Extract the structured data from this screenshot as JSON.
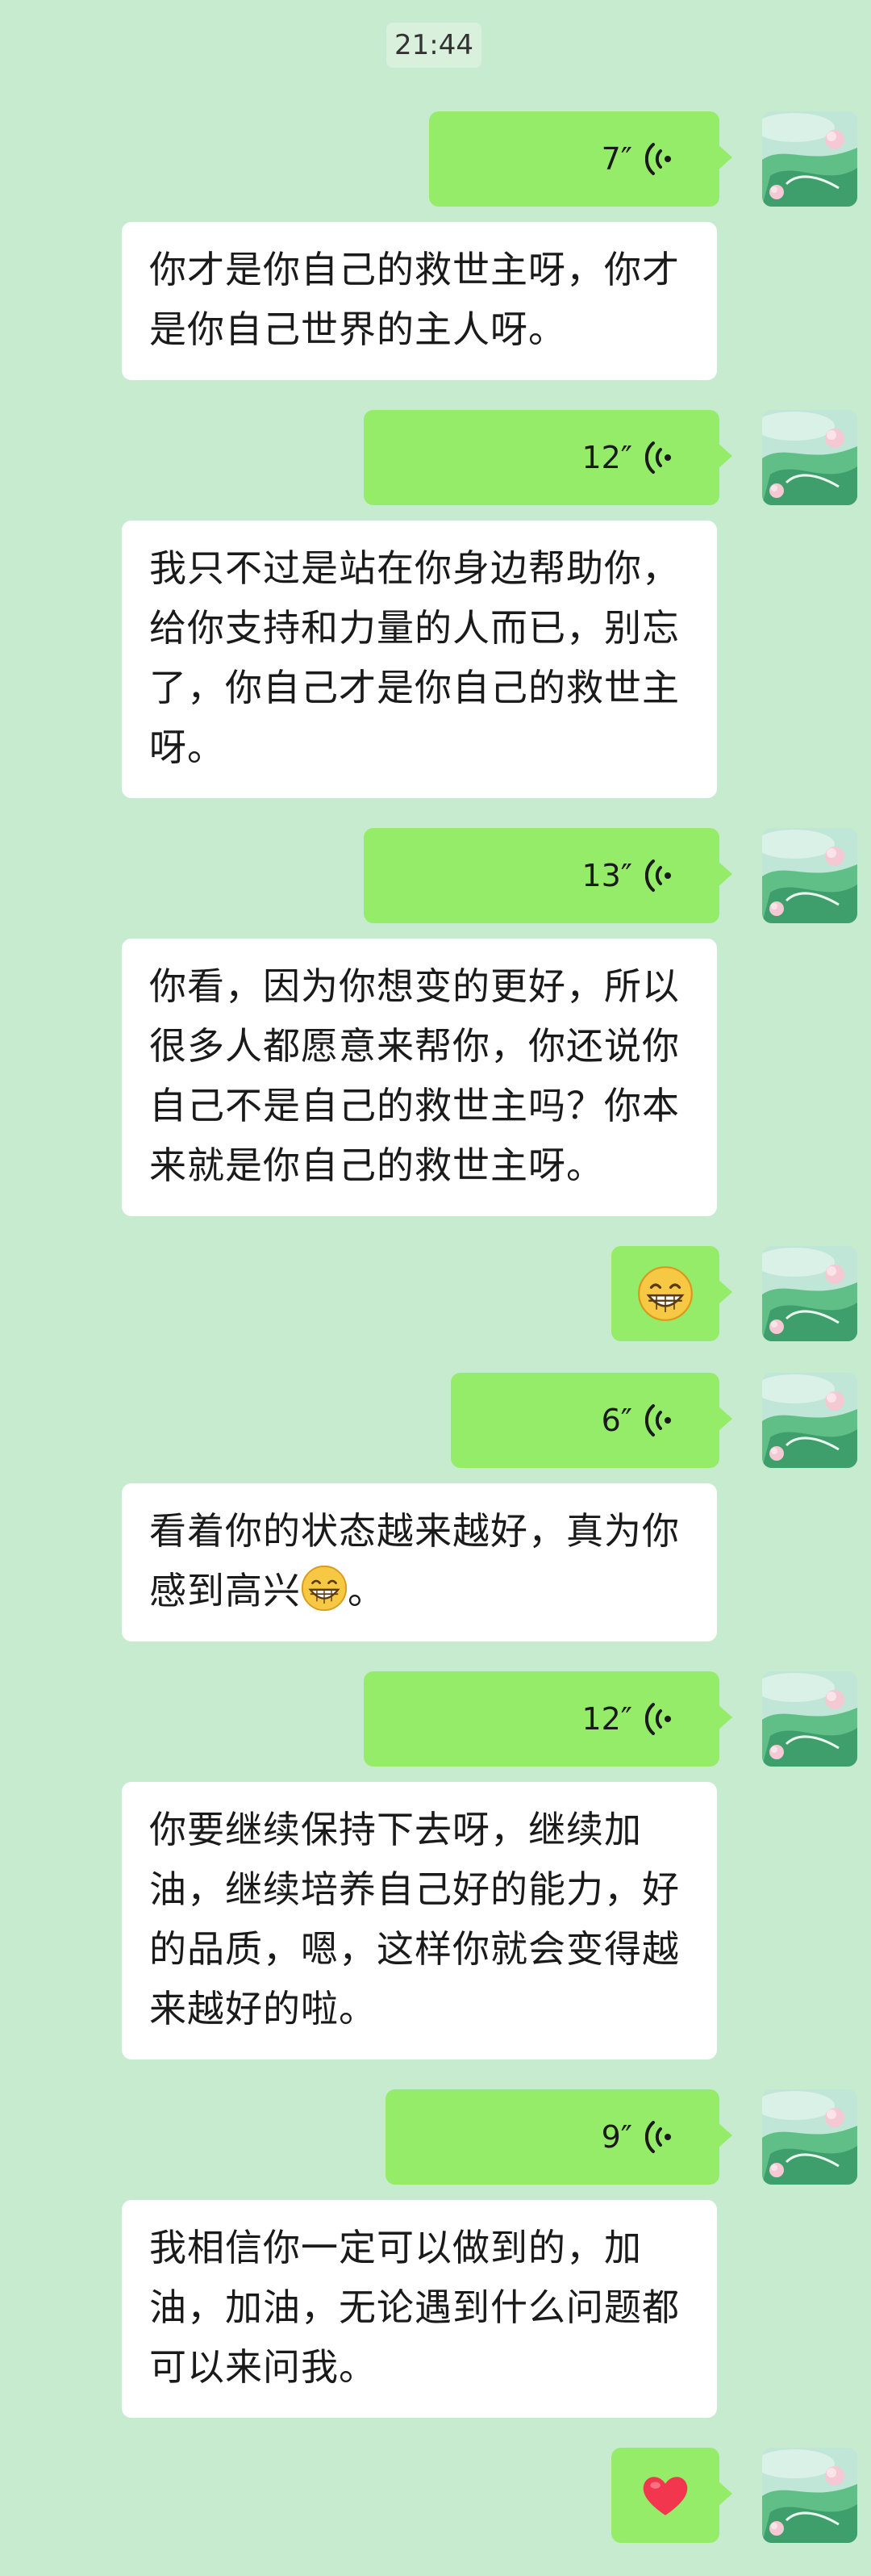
{
  "timestamp": "21:44",
  "colors": {
    "background": "#c7ebcf",
    "sent_bubble": "#95ec69",
    "received_bubble": "#ffffff"
  },
  "messages": [
    {
      "type": "voice",
      "duration": "7″"
    },
    {
      "type": "text",
      "text": "你才是你自己的救世主呀，你才是你自己世界的主人呀。"
    },
    {
      "type": "voice",
      "duration": "12″"
    },
    {
      "type": "text",
      "text": "我只不过是站在你身边帮助你，给你支持和力量的人而已，别忘了，你自己才是你自己的救世主呀。"
    },
    {
      "type": "voice",
      "duration": "13″"
    },
    {
      "type": "text",
      "text": "你看，因为你想变的更好，所以很多人都愿意来帮你，你还说你自己不是自己的救世主吗？你本来就是你自己的救世主呀。"
    },
    {
      "type": "emoji",
      "icon": "grinning-face-icon"
    },
    {
      "type": "voice",
      "duration": "6″"
    },
    {
      "type": "text",
      "text_before": "看着你的状态越来越好，真为你感到高兴",
      "text_after": "。"
    },
    {
      "type": "voice",
      "duration": "12″"
    },
    {
      "type": "text",
      "text": "你要继续保持下去呀，继续加油，继续培养自己好的能力，好的品质，嗯，这样你就会变得越来越好的啦。"
    },
    {
      "type": "voice",
      "duration": "9″"
    },
    {
      "type": "text",
      "text": "我相信你一定可以做到的，加油，加油，无论遇到什么问题都可以来问我。"
    },
    {
      "type": "emoji",
      "icon": "red-heart-icon"
    }
  ]
}
